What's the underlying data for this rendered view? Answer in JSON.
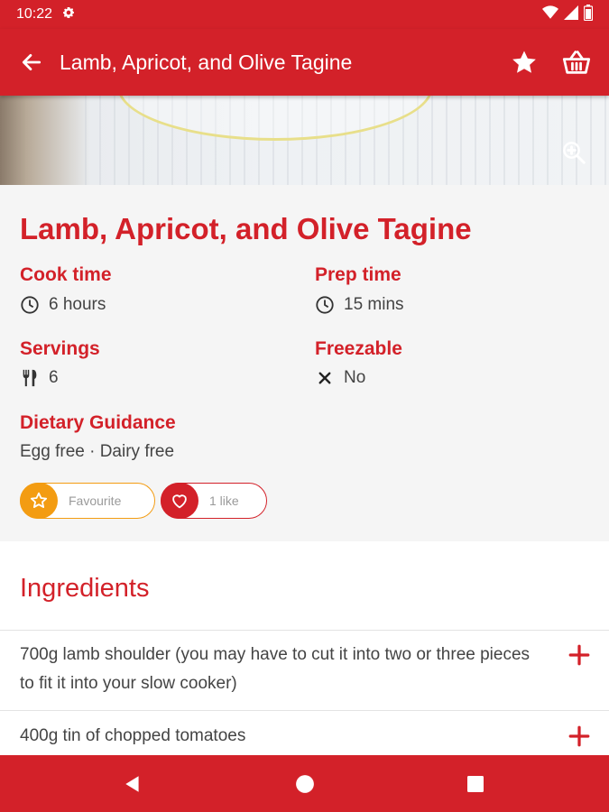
{
  "status_bar": {
    "time": "10:22",
    "icons": [
      "gear-icon",
      "wifi-icon",
      "signal-icon",
      "battery-icon"
    ]
  },
  "app_bar": {
    "title": "Lamb, Apricot, and Olive Tagine",
    "icons": [
      "back-arrow-icon",
      "star-icon",
      "basket-icon"
    ]
  },
  "hero": {
    "icons": [
      "zoom-in-icon"
    ]
  },
  "recipe": {
    "title": "Lamb, Apricot, and Olive Tagine",
    "cook_time": {
      "label": "Cook time",
      "value": "6 hours",
      "icon": "clock-icon"
    },
    "prep_time": {
      "label": "Prep time",
      "value": "15 mins",
      "icon": "clock-icon"
    },
    "servings": {
      "label": "Servings",
      "value": "6",
      "icon": "cutlery-icon"
    },
    "freezable": {
      "label": "Freezable",
      "value": "No",
      "icon": "cross-icon"
    },
    "dietary": {
      "label": "Dietary Guidance",
      "value": "Egg free · Dairy free"
    },
    "favourite_button": {
      "label": "Favourite",
      "icon": "star-outline-icon"
    },
    "like_button": {
      "label": "1 like",
      "icon": "heart-outline-icon"
    }
  },
  "ingredients": {
    "title": "Ingredients",
    "items": [
      "700g lamb shoulder (you may have to cut it into two or three pieces to fit it into your slow cooker)",
      "400g tin of chopped tomatoes"
    ]
  },
  "nav_bar": {
    "icons": [
      "back-triangle-icon",
      "home-circle-icon",
      "recents-square-icon"
    ]
  },
  "colors": {
    "brand_red": "#d32129",
    "accent_orange": "#f39c12",
    "details_bg": "#f5f5f5"
  }
}
